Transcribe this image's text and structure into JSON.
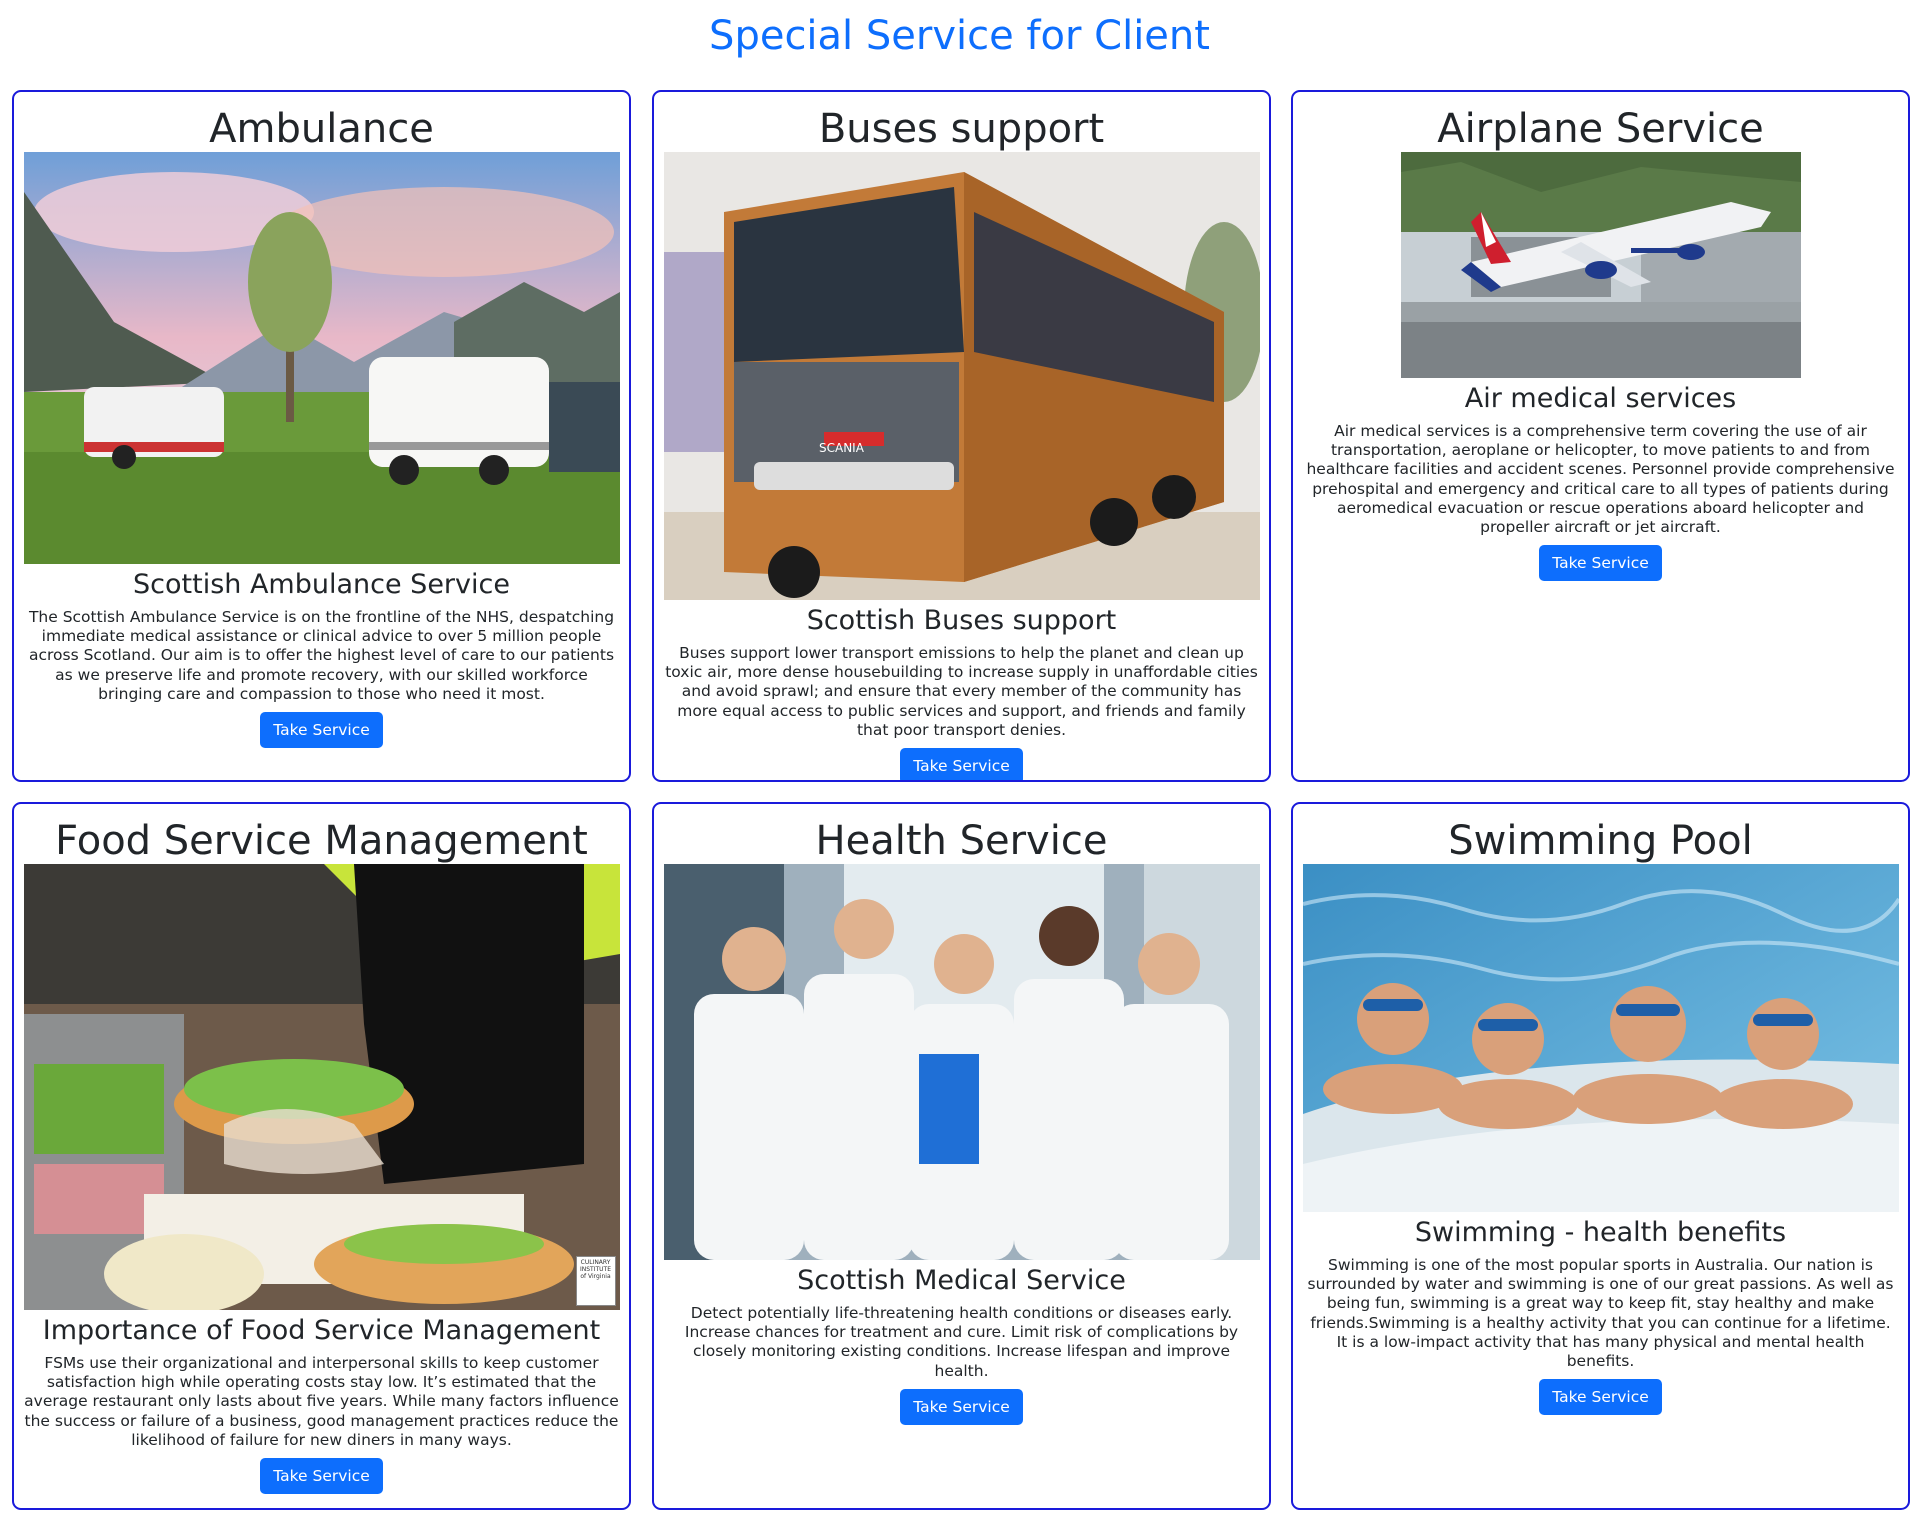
{
  "page": {
    "title": "Special Service for Client"
  },
  "button_label": "Take Service",
  "colors": {
    "accent": "#0d6efd",
    "card_border": "#1a1adb"
  },
  "cards": [
    {
      "title": "Ambulance",
      "subtitle": "Scottish Ambulance Service",
      "description": "The Scottish Ambulance Service is on the frontline of the NHS, despatching immediate medical assistance or clinical advice to over 5 million people across Scotland. Our aim is to offer the highest level of care to our patients as we preserve life and promote recovery, with our skilled workforce bringing care and compassion to those who need it most.",
      "image": "campervans-in-mountain-meadow"
    },
    {
      "title": "Buses support",
      "subtitle": "Scottish Buses support",
      "description": "Buses support lower transport emissions to help the planet and clean up toxic air, more dense housebuilding to increase supply in unaffordable cities and avoid sprawl; and ensure that every member of the community has more equal access to public services and support, and friends and family that poor transport denies.",
      "image": "orange-coach-bus"
    },
    {
      "title": "Airplane Service",
      "subtitle": "Air medical services",
      "description": "Air medical services is a comprehensive term covering the use of air transportation, aeroplane or helicopter, to move patients to and from healthcare facilities and accident scenes. Personnel provide comprehensive prehospital and emergency and critical care to all types of patients during aeromedical evacuation or rescue operations aboard helicopter and propeller aircraft or jet aircraft.",
      "image": "airplane-taking-off"
    },
    {
      "title": "Food Service Management",
      "subtitle": "Importance of Food Service Management",
      "description": "FSMs use their organizational and interpersonal skills to keep customer satisfaction high while operating costs stay low. It’s estimated that the average restaurant only lasts about five years. While many factors influence the success or failure of a business, good management practices reduce the likelihood of failure for new diners in many ways.",
      "image": "sandwich-preparation",
      "badge": "CULINARY INSTITUTE of Virginia"
    },
    {
      "title": "Health Service",
      "subtitle": "Scottish Medical Service",
      "description": "Detect potentially life-threatening health conditions or diseases early. Increase chances for treatment and cure. Limit risk of complications by closely monitoring existing conditions. Increase lifespan and improve health.",
      "image": "medical-team-in-corridor"
    },
    {
      "title": "Swimming Pool",
      "subtitle": "Swimming - health benefits",
      "description": "Swimming is one of the most popular sports in Australia. Our nation is surrounded by water and swimming is one of our great passions. As well as being fun, swimming is a great way to keep fit, stay healthy and make friends.Swimming is a healthy activity that you can continue for a lifetime. It is a low-impact activity that has many physical and mental health benefits.",
      "image": "kids-at-pool-edge"
    }
  ]
}
